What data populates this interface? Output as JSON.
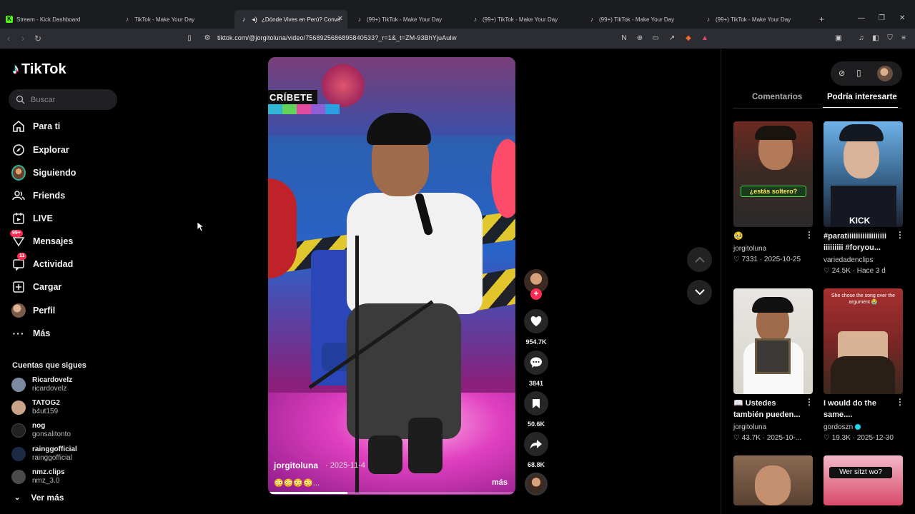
{
  "browser": {
    "tabs": [
      {
        "label": "Stream - Kick Dashboard",
        "icon": "kick-icon"
      },
      {
        "label": "TikTok - Make Your Day",
        "icon": "tiktok-icon"
      },
      {
        "label": "¿Dónde Vives en Perú? Conve",
        "icon": "tiktok-icon",
        "active": true
      },
      {
        "label": "(99+) TikTok - Make Your Day",
        "icon": "tiktok-icon"
      },
      {
        "label": "(99+) TikTok - Make Your Day",
        "icon": "tiktok-icon"
      },
      {
        "label": "(99+) TikTok - Make Your Day",
        "icon": "tiktok-icon"
      },
      {
        "label": "(99+) TikTok - Make Your Day",
        "icon": "tiktok-icon"
      }
    ],
    "new_tab": "+",
    "url": "tiktok.com/@jorgitoluna/video/7568925686895840533?_r=1&_t=ZM-93BhYjuAuIw"
  },
  "sidebar": {
    "logo": "TikTok",
    "search_placeholder": "Buscar",
    "nav": [
      {
        "label": "Para ti",
        "icon": "home-icon"
      },
      {
        "label": "Explorar",
        "icon": "compass-icon"
      },
      {
        "label": "Siguiendo",
        "icon": "following-avatar-icon"
      },
      {
        "label": "Friends",
        "icon": "friends-icon"
      },
      {
        "label": "LIVE",
        "icon": "live-icon"
      },
      {
        "label": "Mensajes",
        "icon": "messages-icon",
        "badge": "99+"
      },
      {
        "label": "Actividad",
        "icon": "activity-icon",
        "badge": "11"
      },
      {
        "label": "Cargar",
        "icon": "upload-icon"
      },
      {
        "label": "Perfil",
        "icon": "profile-avatar-icon"
      },
      {
        "label": "Más",
        "icon": "more-dots-icon"
      }
    ],
    "following_title": "Cuentas que sigues",
    "accounts": [
      {
        "name": "Ricardovelz",
        "handle": "ricardovelz",
        "color": "#7b8aa0"
      },
      {
        "name": "TATOG2",
        "handle": "b4ut159",
        "color": "#c9a38a"
      },
      {
        "name": "nog",
        "handle": "gonsalitonto",
        "color": "#222222"
      },
      {
        "name": "rainggofficial",
        "handle": "rainggofficial",
        "color": "#1c2a44"
      },
      {
        "name": "nmz.clips",
        "handle": "nmz_3.0",
        "color": "#4a4a4a"
      }
    ],
    "see_more": "Ver más"
  },
  "video": {
    "banner": "CRÍBETE",
    "author": "jorgitoluna",
    "date": "· 2025-11-4",
    "caption": "😳😳😳😳...",
    "more": "más",
    "progress": 0.32
  },
  "actions": {
    "likes": "954.7K",
    "comments": "3841",
    "saves": "50.6K",
    "shares": "68.8K"
  },
  "right_panel": {
    "tabs": [
      "Comentarios",
      "Podría interesarte"
    ],
    "active_tab": 1,
    "cards": [
      {
        "title": "🥹",
        "author": "jorgitoluna",
        "likes": "7331",
        "date": "2025-10-25",
        "overlay": "¿estás soltero?"
      },
      {
        "title": "#paratiiiiiiiiiiiiiiiiii iiiiiiiii #foryou...",
        "author": "variedadenclips",
        "likes": "24.5K",
        "date": "Hace 3 d",
        "overlay": "KICK"
      },
      {
        "title": "📖 Ustedes también pueden...",
        "author": "jorgitoluna",
        "likes": "43.7K",
        "date": "2025-10-...",
        "overlay": ""
      },
      {
        "title": "I would do the same....",
        "author": "gordoszn",
        "likes": "19.3K",
        "date": "2025-12-30",
        "overlay": "She chose the song over the argument 😭"
      },
      {
        "title": "",
        "author": "",
        "likes": "",
        "date": "",
        "overlay": ""
      },
      {
        "title": "",
        "author": "",
        "likes": "",
        "date": "",
        "overlay": "Wer sitzt wo?"
      }
    ]
  },
  "colors": {
    "accent": "#fe2c55",
    "bg": "#000000"
  }
}
